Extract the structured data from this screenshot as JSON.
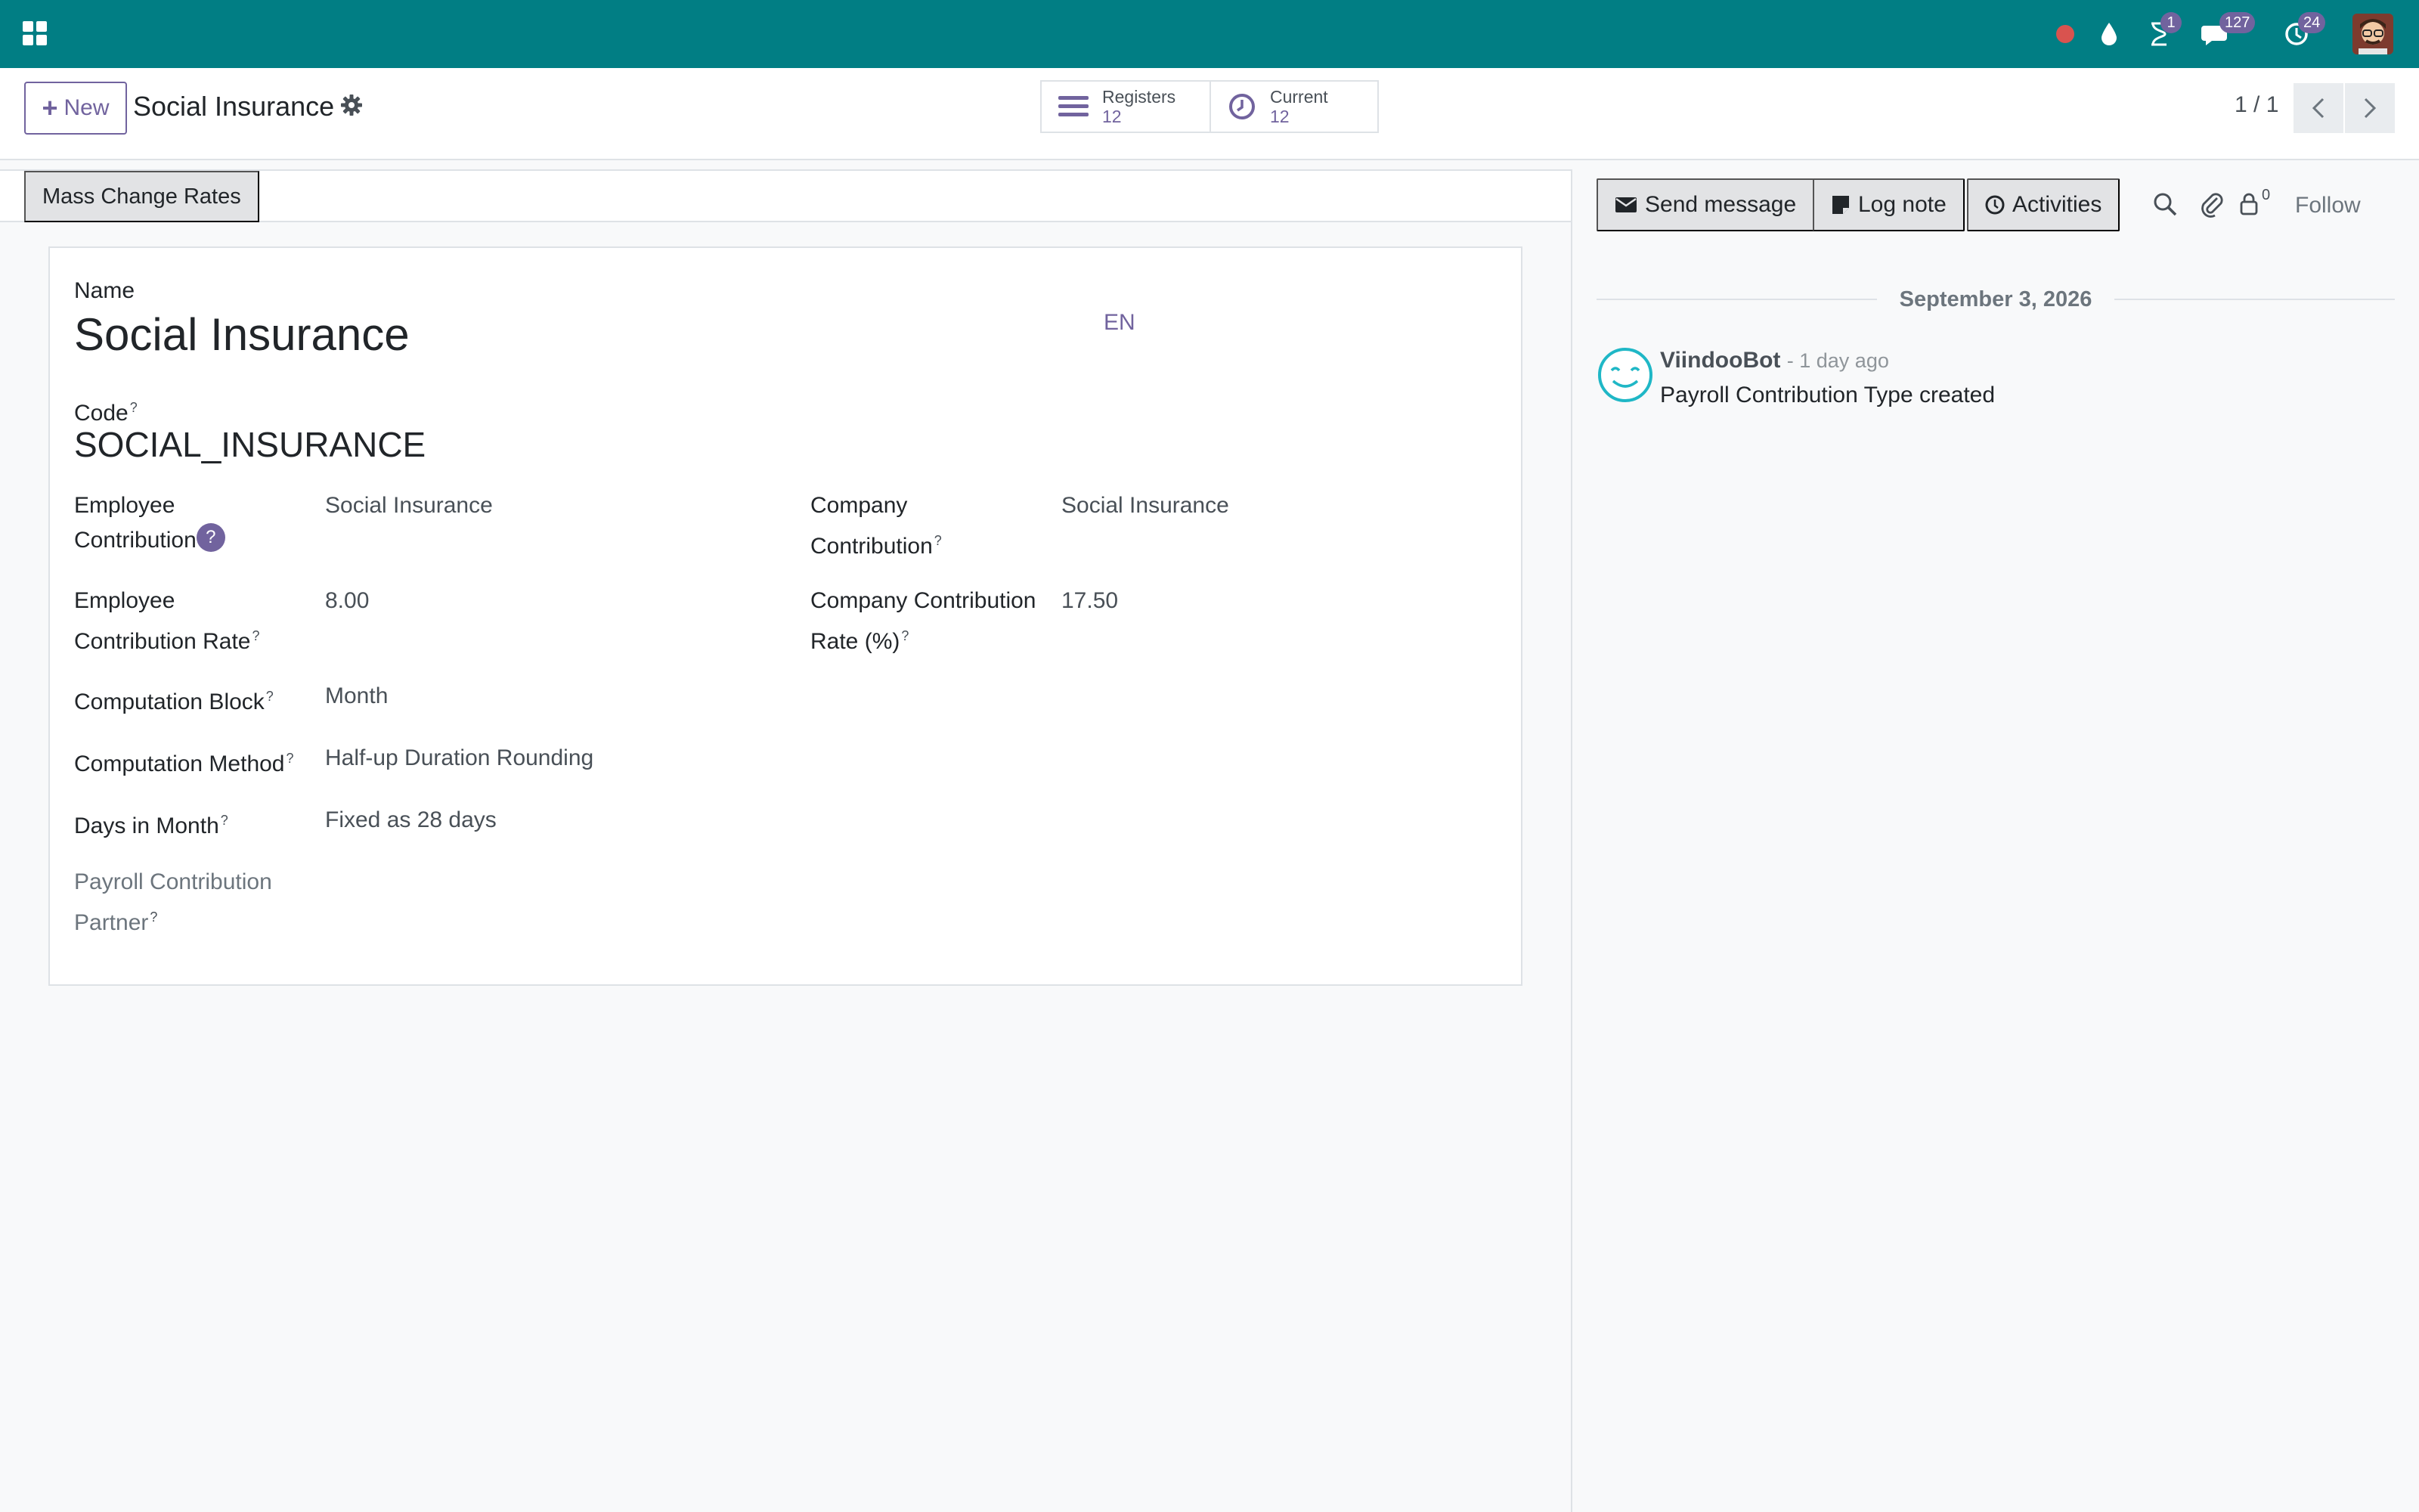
{
  "navbar": {
    "badges": {
      "activities": "1",
      "messages": "127",
      "timesheet": "24"
    }
  },
  "control_panel": {
    "new_label": "New",
    "breadcrumb_title": "Social Insurance",
    "smart_buttons": [
      {
        "label": "Registers",
        "count": "12"
      },
      {
        "label": "Current",
        "count": "12"
      }
    ],
    "pager": "1 / 1"
  },
  "statusbar": {
    "mass_change_label": "Mass Change Rates"
  },
  "form": {
    "name_label": "Name",
    "name_value": "Social Insurance",
    "lang_label": "EN",
    "code_label": "Code",
    "code_value": "SOCIAL_INSURANCE",
    "help_mark": "?",
    "employee_contribution_label_1": "Employee",
    "employee_contribution_label_2": "Contribution",
    "employee_contribution_value": "Social Insurance",
    "company_contribution_label_1": "Company",
    "company_contribution_label_2": "Contribution",
    "company_contribution_value": "Social Insurance",
    "employee_rate_label_1": "Employee",
    "employee_rate_label_2": "Contribution Rate",
    "employee_rate_value": "8.00",
    "company_rate_label_1": "Company Contribution",
    "company_rate_label_2": "Rate (%)",
    "company_rate_value": "17.50",
    "computation_block_label": "Computation Block",
    "computation_block_value": "Month",
    "computation_method_label": "Computation Method",
    "computation_method_value": "Half-up Duration Rounding",
    "days_in_month_label": "Days in Month",
    "days_in_month_value": "Fixed as 28 days",
    "partner_label_1": "Payroll Contribution",
    "partner_label_2": "Partner"
  },
  "chatter": {
    "send_message_label": "Send message",
    "log_note_label": "Log note",
    "activities_label": "Activities",
    "followers_count": "0",
    "follow_label": "Follow",
    "date_separator": "September 3, 2026",
    "messages": [
      {
        "author": "ViindooBot",
        "time": "- 1 day ago",
        "body": "Payroll Contribution Type created"
      }
    ]
  },
  "colors": {
    "navbar": "#017e84",
    "accent": "#71639e",
    "bot_avatar": "#1fb7c6"
  }
}
